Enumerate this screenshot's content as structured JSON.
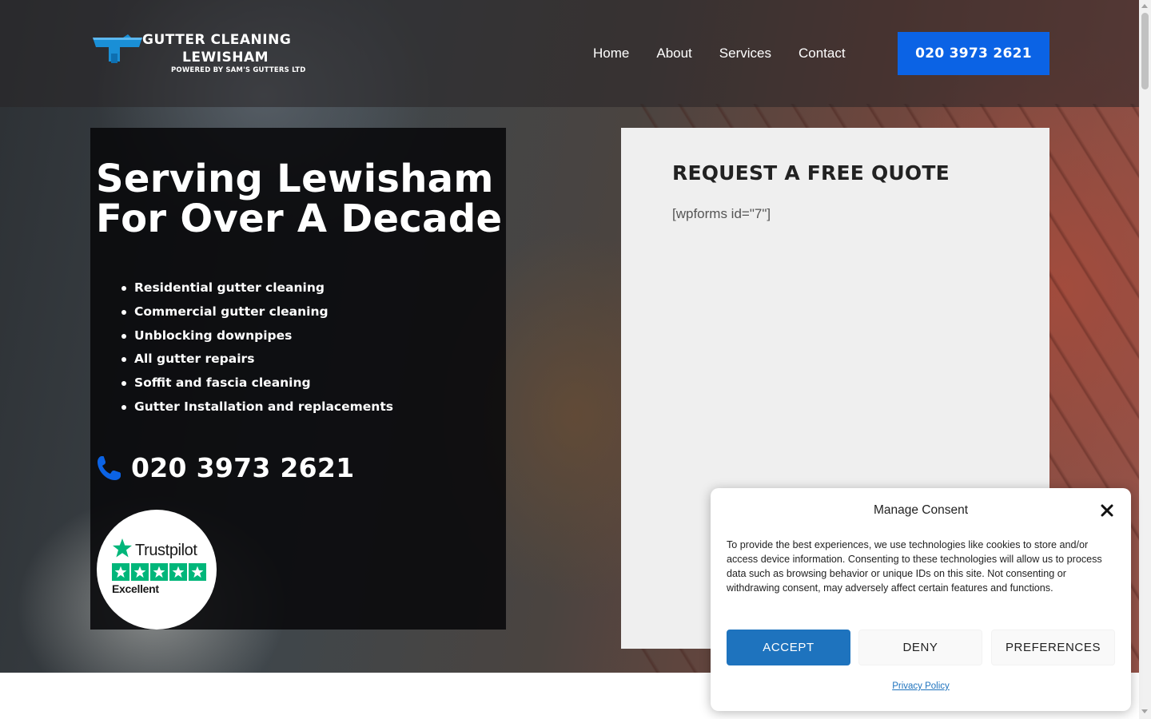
{
  "brand": {
    "name_line1": "GUTTER CLEANING",
    "name_line2": "LEWISHAM",
    "tagline": "POWERED BY SAM'S GUTTERS LTD",
    "accent_color": "#0b63e5"
  },
  "nav": {
    "items": [
      {
        "label": "Home"
      },
      {
        "label": "About"
      },
      {
        "label": "Services"
      },
      {
        "label": "Contact"
      }
    ],
    "phone_button_label": "020 3973 2621"
  },
  "hero": {
    "headline": "Serving Lewisham For Over A Decade",
    "services": [
      "Residential gutter cleaning",
      "Commercial gutter cleaning",
      "Unblocking downpipes",
      "All gutter repairs",
      "Soffit and fascia cleaning",
      "Gutter Installation and replacements"
    ],
    "phone_icon": "phone-icon",
    "phone_number": "020 3973 2621",
    "trustpilot": {
      "name": "Trustpilot",
      "rating_text": "Excellent",
      "stars": 5,
      "color": "#00b67a"
    }
  },
  "quote": {
    "title": "REQUEST A FREE QUOTE",
    "shortcode": "[wpforms id=\"7\"]"
  },
  "consent": {
    "title": "Manage Consent",
    "close_icon": "close-icon",
    "body": "To provide the best experiences, we use technologies like cookies to store and/or access device information. Consenting to these technologies will allow us to process data such as browsing behavior or unique IDs on this site. Not consenting or withdrawing consent, may adversely affect certain features and functions.",
    "accept_label": "ACCEPT",
    "deny_label": "DENY",
    "preferences_label": "PREFERENCES",
    "privacy_link": "Privacy Policy",
    "accept_color": "#1e73be"
  }
}
